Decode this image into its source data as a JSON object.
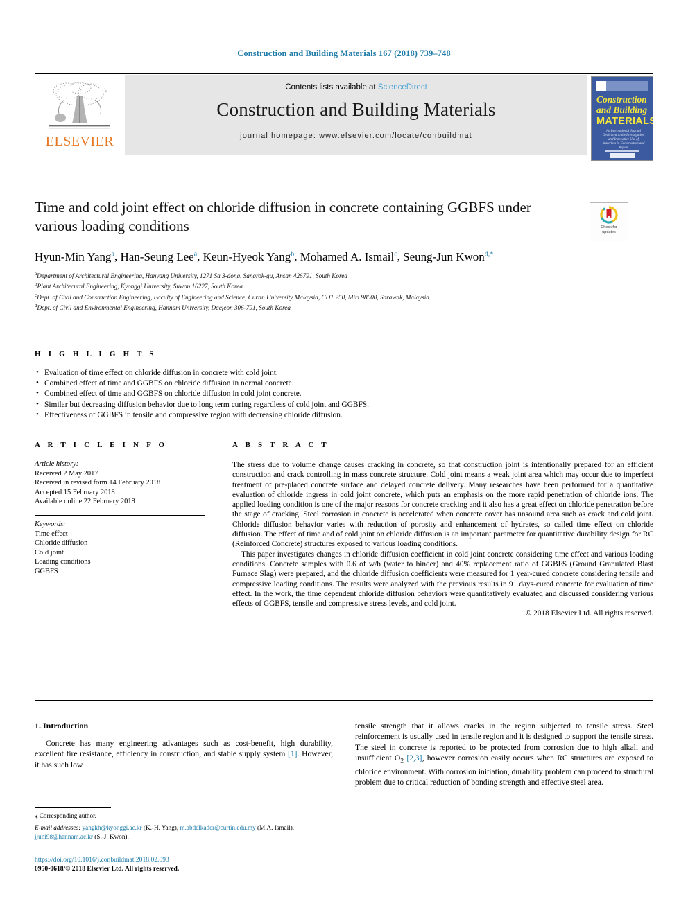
{
  "running_head": "Construction and Building Materials 167 (2018) 739–748",
  "masthead": {
    "contents_prefix": "Contents lists available at ",
    "sciencedirect": "ScienceDirect",
    "journal_name": "Construction and Building Materials",
    "homepage": "journal homepage: www.elsevier.com/locate/conbuildmat",
    "publisher_wordmark": "ELSEVIER",
    "cover": {
      "line1": "Construction",
      "line2": "and Building",
      "line3": "MATERIALS",
      "blurb": "An International Journal Dedicated to the Investigation and Innovative Use of Materials in Construction and Repair"
    }
  },
  "crossmark": {
    "line1": "Check for",
    "line2": "updates"
  },
  "title": "Time and cold joint effect on chloride diffusion in concrete containing GGBFS under various loading conditions",
  "authors": [
    {
      "name": "Hyun-Min Yang",
      "mark": "a"
    },
    {
      "name": "Han-Seung Lee",
      "mark": "a"
    },
    {
      "name": "Keun-Hyeok Yang",
      "mark": "b"
    },
    {
      "name": "Mohamed A. Ismail",
      "mark": "c"
    },
    {
      "name": "Seung-Jun Kwon",
      "mark": "d,*"
    }
  ],
  "affiliations": [
    {
      "mark": "a",
      "text": "Department of Architectural Engineering, Hanyang University, 1271 Sa 3-dong, Sangrok-gu, Ansan 426791, South Korea"
    },
    {
      "mark": "b",
      "text": "Plant Architecural Engineering, Kyonggi University, Suwon 16227, South Korea"
    },
    {
      "mark": "c",
      "text": "Dept. of Civil and Construction Engineering, Faculty of Engineering and Science, Curtin University Malaysia, CDT 250, Miri 98000, Sarawak, Malaysia"
    },
    {
      "mark": "d",
      "text": "Dept. of Civil and Environmental Engineering, Hannam University, Daejeon 306-791, South Korea"
    }
  ],
  "highlights": {
    "heading": "H I G H L I G H T S",
    "items": [
      "Evaluation of time effect on chloride diffusion in concrete with cold joint.",
      "Combined effect of time and GGBFS on chloride diffusion in normal concrete.",
      "Combined effect of time and GGBFS on chloride diffusion in cold joint concrete.",
      "Similar but decreasing diffusion behavior due to long term curing regardless of cold joint and GGBFS.",
      "Effectiveness of GGBFS in tensile and compressive region with decreasing chloride diffusion."
    ]
  },
  "article_info": {
    "heading": "A R T I C L E  I N F O",
    "history_label": "Article history:",
    "history": [
      "Received 2 May 2017",
      "Received in revised form 14 February 2018",
      "Accepted 15 February 2018",
      "Available online 22 February 2018"
    ],
    "keywords_label": "Keywords:",
    "keywords": [
      "Time effect",
      "Chloride diffusion",
      "Cold joint",
      "Loading conditions",
      "GGBFS"
    ]
  },
  "abstract": {
    "heading": "A B S T R A C T",
    "paragraph1": "The stress due to volume change causes cracking in concrete, so that construction joint is intentionally prepared for an efficient construction and crack controlling in mass concrete structure. Cold joint means a weak joint area which may occur due to imperfect treatment of pre-placed concrete surface and delayed concrete delivery. Many researches have been performed for a quantitative evaluation of chloride ingress in cold joint concrete, which puts an emphasis on the more rapid penetration of chloride ions. The applied loading condition is one of the major reasons for concrete cracking and it also has a great effect on chloride penetration before the stage of cracking. Steel corrosion in concrete is accelerated when concrete cover has unsound area such as crack and cold joint. Chloride diffusion behavior varies with reduction of porosity and enhancement of hydrates, so called time effect on chloride diffusion. The effect of time and of cold joint on chloride diffusion is an important parameter for quantitative durability design for RC (Reinforced Concrete) structures exposed to various loading conditions.",
    "paragraph2": "This paper investigates changes in chloride diffusion coefficient in cold joint concrete considering time effect and various loading conditions. Concrete samples with 0.6 of w/b (water to binder) and 40% replacement ratio of GGBFS (Ground Granulated Blast Furnace Slag) were prepared, and the chloride diffusion coefficients were measured for 1 year-cured concrete considering tensile and compressive loading conditions. The results were analyzed with the previous results in 91 days-cured concrete for evaluation of time effect. In the work, the time dependent chloride diffusion behaviors were quantitatively evaluated and discussed considering various effects of GGBFS, tensile and compressive stress levels, and cold joint.",
    "copyright": "© 2018 Elsevier Ltd. All rights reserved."
  },
  "introduction": {
    "section_title": "1. Introduction",
    "left_text_a": "Concrete has many engineering advantages such as cost-benefit, high durability, excellent fire resistance, efficiency in construction, and stable supply system ",
    "left_ref": "[1]",
    "left_text_b": ". However, it has such low",
    "right_text_a": "tensile strength that it allows cracks in the region subjected to tensile stress. Steel reinforcement is usually used in tensile region and it is designed to support the tensile stress. The steel in concrete is reported to be protected from corrosion due to high alkali and insufficient O",
    "right_sub": "2",
    "right_ref": " [2,3]",
    "right_text_b": ", however corrosion easily occurs when RC structures are exposed to chloride environment. With corrosion initiation, durability problem can proceed to structural problem due to critical reduction of bonding strength and effective steel area."
  },
  "footnote": {
    "star": "⁎",
    "corresponding": "Corresponding author.",
    "email_label": "E-mail addresses:",
    "email1": "yangkh@kyonggi.ac.kr",
    "email1_who": " (K.-H. Yang), ",
    "email2": "m.abdelkader@curtin.edu.my",
    "email2_who": " (M.A. Ismail), ",
    "email3": "jjuni98@hannam.ac.kr",
    "email3_who": " (S.-J. Kwon)."
  },
  "doi": "https://doi.org/10.1016/j.conbuildmat.2018.02.093",
  "issn_line": "0950-0618/© 2018 Elsevier Ltd. All rights reserved.",
  "colors": {
    "link_blue": "#1f7ba8",
    "sciencedirect_blue": "#4aa3d6",
    "elsevier_orange": "#E87722",
    "cover_blue": "#3b5aa0",
    "cover_yellow": "#f5e63c"
  }
}
